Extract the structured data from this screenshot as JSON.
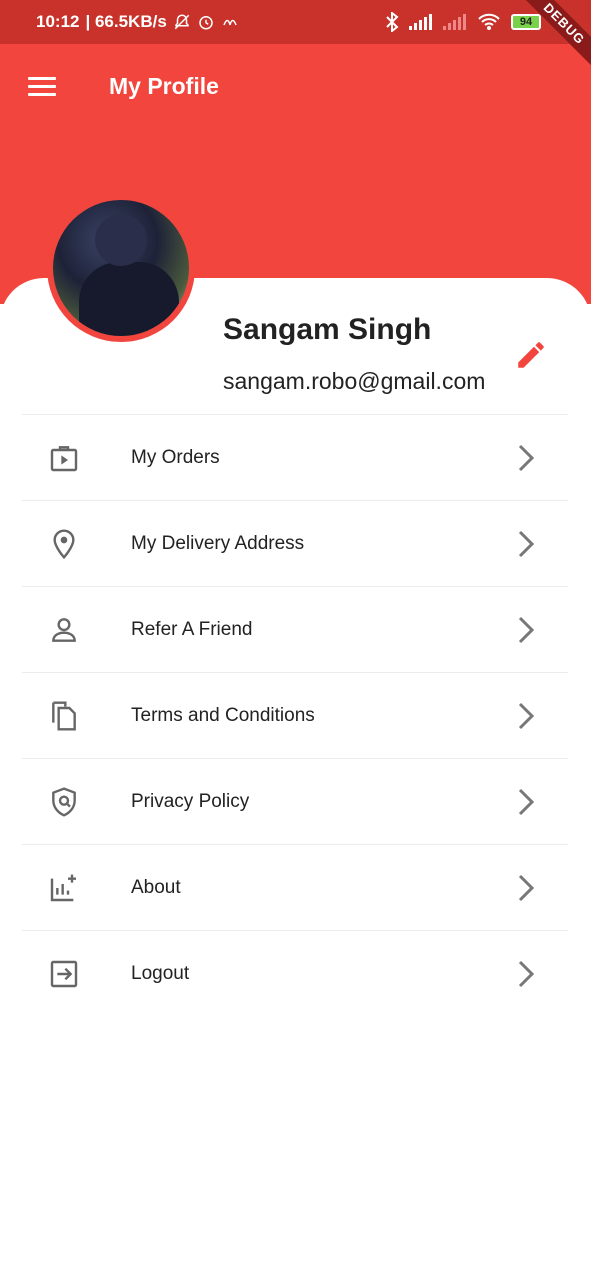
{
  "status_bar": {
    "time": "10:12",
    "speed": "| 66.5KB/s",
    "battery": "94",
    "debug": "DEBUG"
  },
  "app_bar": {
    "title": "My Profile",
    "color": "#f1453d"
  },
  "profile": {
    "name": "Sangam Singh",
    "email": "sangam.robo@gmail.com"
  },
  "menu": [
    {
      "label": "My Orders",
      "icon": "orders-icon"
    },
    {
      "label": "My Delivery Address",
      "icon": "location-icon"
    },
    {
      "label": "Refer A Friend",
      "icon": "person-icon"
    },
    {
      "label": "Terms and Conditions",
      "icon": "documents-icon"
    },
    {
      "label": "Privacy Policy",
      "icon": "shield-icon"
    },
    {
      "label": "About",
      "icon": "analytics-icon"
    },
    {
      "label": "Logout",
      "icon": "logout-icon"
    }
  ]
}
